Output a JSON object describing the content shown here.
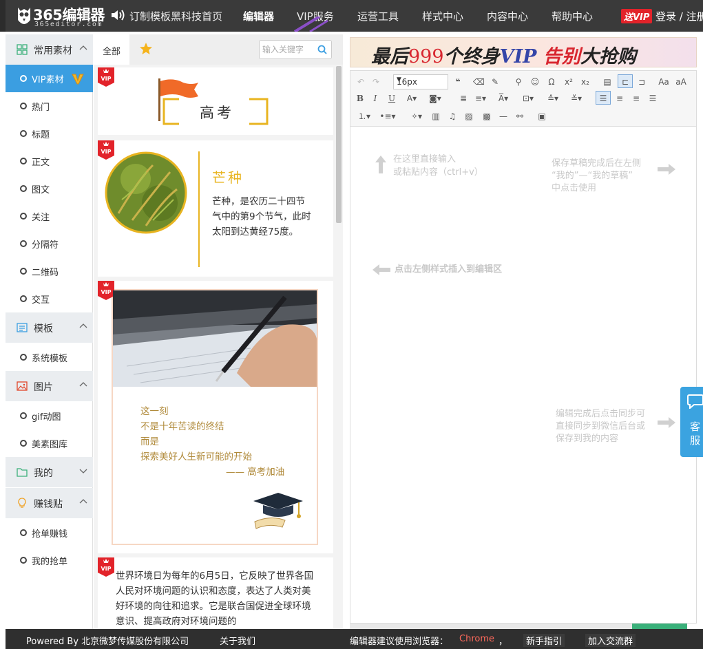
{
  "header": {
    "logo_text": "365编辑器",
    "logo_domain": "365editor.com",
    "nav": [
      {
        "label": "订制模板黑科技首页"
      },
      {
        "label": "编辑器",
        "active": true
      },
      {
        "label": "VIP服务"
      },
      {
        "label": "运营工具"
      },
      {
        "label": "样式中心"
      },
      {
        "label": "内容中心"
      },
      {
        "label": "帮助中心"
      }
    ],
    "vip_badge": "送VIP",
    "login": "登录 / 注册"
  },
  "sidebar": {
    "cat_common": "常用素材",
    "items_common": [
      "VIP素材",
      "热门",
      "标题",
      "正文",
      "图文",
      "关注",
      "分隔符",
      "二维码",
      "交互"
    ],
    "cat_template": "模板",
    "items_template": [
      "系统模板"
    ],
    "cat_image": "图片",
    "items_image": [
      "gif动图",
      "美素图库"
    ],
    "cat_mine": "我的",
    "cat_earn": "赚钱贴",
    "items_earn": [
      "抢单赚钱",
      "我的抢单"
    ]
  },
  "material": {
    "tab_all": "全部",
    "search_placeholder": "输入关键字",
    "vip_label": "VIP",
    "card1_title": "高考",
    "card2_title": "芒种",
    "card2_body": "芒种，是农历二十四节气中的第9个节气，此时太阳到达黄经75度。",
    "card3_lines": [
      "这一刻",
      "不是十年苦读的终结",
      "而是",
      "探索美好人生新可能的开始"
    ],
    "card3_sign": "—— 高考加油",
    "card4_body": "世界环境日为每年的6月5日，它反映了世界各国人民对环境问题的认识和态度，表达了人类对美好环境的向往和追求。它是联合国促进全球环境意识、提高政府对环境问题的"
  },
  "editor": {
    "banner_parts": [
      "最后",
      "999",
      "个终身",
      "VIP",
      " 告别",
      "大抢购"
    ],
    "font_size": "16px",
    "hint_input_1": "在这里直接输入",
    "hint_input_2": "或粘贴内容（ctrl+v）",
    "hint_draft_1": "保存草稿完成后在左侧",
    "hint_draft_2": "“我的”—“我的草稿”",
    "hint_draft_3": "中点击使用",
    "hint_insert": "点击左侧样式插入到编辑区",
    "hint_sync_1": "编辑完成后点击同步可",
    "hint_sync_2": "直接同步到微信后台或",
    "hint_sync_3": "保存到我的内容",
    "service_label": "客服"
  },
  "footer": {
    "powered": "Powered By 北京微梦传媒股份有限公司",
    "about": "关于我们",
    "browser_hint": "编辑器建议使用浏览器：",
    "browser": "Chrome",
    "comma": "，",
    "guide": "新手指引",
    "group": "加入交流群"
  },
  "colors": {
    "topbar": "#3a3a3a",
    "accent_blue": "#3b9ee1",
    "vip_red": "#e2232a",
    "gold": "#e8b420",
    "footer": "#2f2f2f"
  }
}
